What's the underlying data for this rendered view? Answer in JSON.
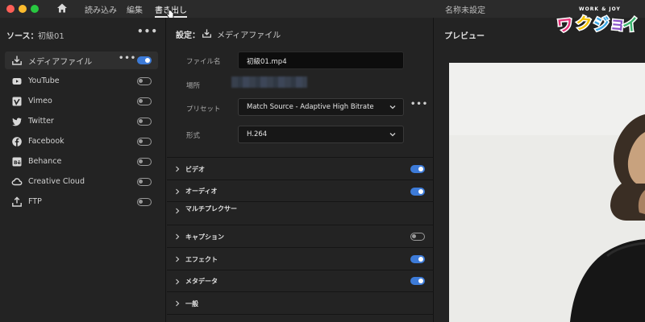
{
  "titlebar": {
    "menus": [
      "読み込み",
      "編集",
      "書き出し"
    ],
    "active_menu": "書き出し",
    "window_title": "名称未設定",
    "logo_top": "WORK & JOY",
    "logo_text": "ワクジョイ"
  },
  "source": {
    "label": "ソース：",
    "name": "初級01",
    "destinations": [
      {
        "label": "メディアファイル",
        "icon": "download-icon",
        "enabled": true,
        "selected": true
      },
      {
        "label": "YouTube",
        "icon": "youtube-icon",
        "enabled": false
      },
      {
        "label": "Vimeo",
        "icon": "vimeo-icon",
        "enabled": false
      },
      {
        "label": "Twitter",
        "icon": "twitter-icon",
        "enabled": false
      },
      {
        "label": "Facebook",
        "icon": "facebook-icon",
        "enabled": false
      },
      {
        "label": "Behance",
        "icon": "behance-icon",
        "enabled": false
      },
      {
        "label": "Creative Cloud",
        "icon": "creative-cloud-icon",
        "enabled": false
      },
      {
        "label": "FTP",
        "icon": "ftp-icon",
        "enabled": false
      }
    ]
  },
  "settings": {
    "label": "設定：",
    "target": "メディアファイル",
    "filename_label": "ファイル名",
    "filename_value": "初級01.mp4",
    "location_label": "場所",
    "preset_label": "プリセット",
    "preset_value": "Match Source - Adaptive High Bitrate",
    "format_label": "形式",
    "format_value": "H.264",
    "sections": [
      {
        "label": "ビデオ",
        "toggle": "on"
      },
      {
        "label": "オーディオ",
        "toggle": "on"
      },
      {
        "label": "マルチプレクサー",
        "toggle": "none"
      },
      {
        "label": "キャプション",
        "toggle": "off"
      },
      {
        "label": "エフェクト",
        "toggle": "on"
      },
      {
        "label": "メタデータ",
        "toggle": "on"
      },
      {
        "label": "一般",
        "toggle": "none"
      }
    ]
  },
  "preview": {
    "label": "プレビュー"
  }
}
